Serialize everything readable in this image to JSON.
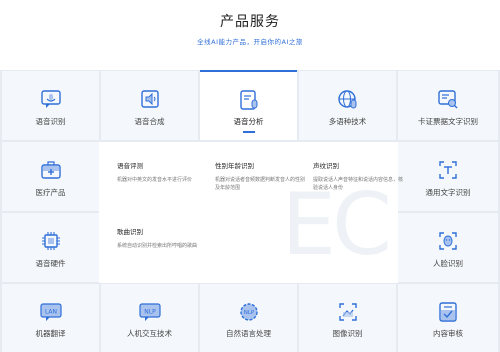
{
  "header": {
    "title": "产品服务",
    "subtitle": "全线AI能力产品，开启你的AI之旅"
  },
  "cells": [
    {
      "label": "语音识别",
      "icon": "mic-bubble-icon"
    },
    {
      "label": "语音合成",
      "icon": "speaker-icon"
    },
    {
      "label": "语音分析",
      "icon": "document-mic-icon",
      "active": true
    },
    {
      "label": "多语种技术",
      "icon": "globe-mic-icon"
    },
    {
      "label": "卡证票据文字识别",
      "icon": "card-scan-icon"
    },
    {
      "label": "医疗产品",
      "icon": "medical-kit-icon"
    },
    {
      "label": "通用文字识别",
      "icon": "text-scan-icon"
    },
    {
      "label": "语音硬件",
      "icon": "chip-icon"
    },
    {
      "label": "人脸识别",
      "icon": "face-scan-icon"
    },
    {
      "label": "机器翻译",
      "icon": "translate-icon"
    },
    {
      "label": "人机交互技术",
      "icon": "nlp-chat-icon"
    },
    {
      "label": "自然语言处理",
      "icon": "nlp-gear-icon"
    },
    {
      "label": "图像识别",
      "icon": "image-scan-icon"
    },
    {
      "label": "内容审核",
      "icon": "checklist-icon"
    }
  ],
  "submenu": [
    {
      "title": "语音评测",
      "desc": "机器对中英文的发音水平进行评价"
    },
    {
      "title": "性别年龄识别",
      "desc": "机器对说话者音频数据判断发音人的性别及年龄范围"
    },
    {
      "title": "声纹识别",
      "desc": "提取说话人声音特征和说话内容信息，核验说话人身份"
    },
    {
      "title": "歌曲识别",
      "desc": "系统自动识别并检索出所哼唱的歌曲"
    }
  ],
  "watermark": "EC",
  "colors": {
    "accent": "#2f6fd8",
    "cell_bg": "#f4f7fb",
    "grid_line": "#e6ebf2"
  }
}
